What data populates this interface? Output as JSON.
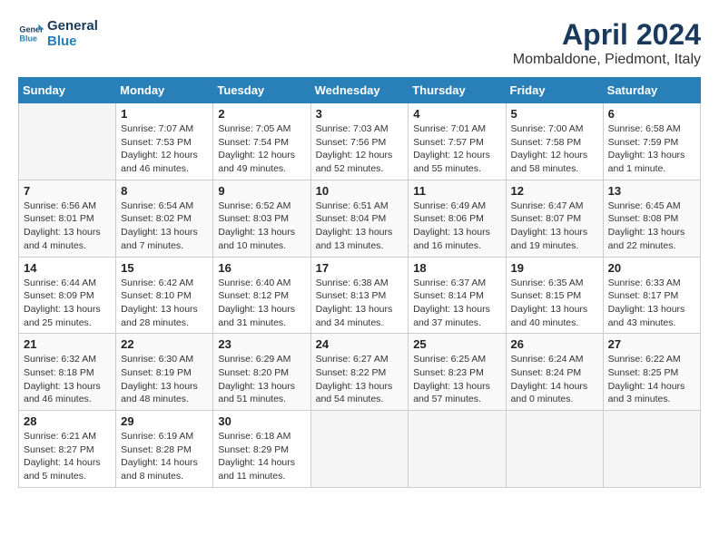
{
  "header": {
    "logo_line1": "General",
    "logo_line2": "Blue",
    "month_title": "April 2024",
    "location": "Mombaldone, Piedmont, Italy"
  },
  "columns": [
    "Sunday",
    "Monday",
    "Tuesday",
    "Wednesday",
    "Thursday",
    "Friday",
    "Saturday"
  ],
  "weeks": [
    [
      {
        "day": "",
        "info": ""
      },
      {
        "day": "1",
        "info": "Sunrise: 7:07 AM\nSunset: 7:53 PM\nDaylight: 12 hours\nand 46 minutes."
      },
      {
        "day": "2",
        "info": "Sunrise: 7:05 AM\nSunset: 7:54 PM\nDaylight: 12 hours\nand 49 minutes."
      },
      {
        "day": "3",
        "info": "Sunrise: 7:03 AM\nSunset: 7:56 PM\nDaylight: 12 hours\nand 52 minutes."
      },
      {
        "day": "4",
        "info": "Sunrise: 7:01 AM\nSunset: 7:57 PM\nDaylight: 12 hours\nand 55 minutes."
      },
      {
        "day": "5",
        "info": "Sunrise: 7:00 AM\nSunset: 7:58 PM\nDaylight: 12 hours\nand 58 minutes."
      },
      {
        "day": "6",
        "info": "Sunrise: 6:58 AM\nSunset: 7:59 PM\nDaylight: 13 hours\nand 1 minute."
      }
    ],
    [
      {
        "day": "7",
        "info": "Sunrise: 6:56 AM\nSunset: 8:01 PM\nDaylight: 13 hours\nand 4 minutes."
      },
      {
        "day": "8",
        "info": "Sunrise: 6:54 AM\nSunset: 8:02 PM\nDaylight: 13 hours\nand 7 minutes."
      },
      {
        "day": "9",
        "info": "Sunrise: 6:52 AM\nSunset: 8:03 PM\nDaylight: 13 hours\nand 10 minutes."
      },
      {
        "day": "10",
        "info": "Sunrise: 6:51 AM\nSunset: 8:04 PM\nDaylight: 13 hours\nand 13 minutes."
      },
      {
        "day": "11",
        "info": "Sunrise: 6:49 AM\nSunset: 8:06 PM\nDaylight: 13 hours\nand 16 minutes."
      },
      {
        "day": "12",
        "info": "Sunrise: 6:47 AM\nSunset: 8:07 PM\nDaylight: 13 hours\nand 19 minutes."
      },
      {
        "day": "13",
        "info": "Sunrise: 6:45 AM\nSunset: 8:08 PM\nDaylight: 13 hours\nand 22 minutes."
      }
    ],
    [
      {
        "day": "14",
        "info": "Sunrise: 6:44 AM\nSunset: 8:09 PM\nDaylight: 13 hours\nand 25 minutes."
      },
      {
        "day": "15",
        "info": "Sunrise: 6:42 AM\nSunset: 8:10 PM\nDaylight: 13 hours\nand 28 minutes."
      },
      {
        "day": "16",
        "info": "Sunrise: 6:40 AM\nSunset: 8:12 PM\nDaylight: 13 hours\nand 31 minutes."
      },
      {
        "day": "17",
        "info": "Sunrise: 6:38 AM\nSunset: 8:13 PM\nDaylight: 13 hours\nand 34 minutes."
      },
      {
        "day": "18",
        "info": "Sunrise: 6:37 AM\nSunset: 8:14 PM\nDaylight: 13 hours\nand 37 minutes."
      },
      {
        "day": "19",
        "info": "Sunrise: 6:35 AM\nSunset: 8:15 PM\nDaylight: 13 hours\nand 40 minutes."
      },
      {
        "day": "20",
        "info": "Sunrise: 6:33 AM\nSunset: 8:17 PM\nDaylight: 13 hours\nand 43 minutes."
      }
    ],
    [
      {
        "day": "21",
        "info": "Sunrise: 6:32 AM\nSunset: 8:18 PM\nDaylight: 13 hours\nand 46 minutes."
      },
      {
        "day": "22",
        "info": "Sunrise: 6:30 AM\nSunset: 8:19 PM\nDaylight: 13 hours\nand 48 minutes."
      },
      {
        "day": "23",
        "info": "Sunrise: 6:29 AM\nSunset: 8:20 PM\nDaylight: 13 hours\nand 51 minutes."
      },
      {
        "day": "24",
        "info": "Sunrise: 6:27 AM\nSunset: 8:22 PM\nDaylight: 13 hours\nand 54 minutes."
      },
      {
        "day": "25",
        "info": "Sunrise: 6:25 AM\nSunset: 8:23 PM\nDaylight: 13 hours\nand 57 minutes."
      },
      {
        "day": "26",
        "info": "Sunrise: 6:24 AM\nSunset: 8:24 PM\nDaylight: 14 hours\nand 0 minutes."
      },
      {
        "day": "27",
        "info": "Sunrise: 6:22 AM\nSunset: 8:25 PM\nDaylight: 14 hours\nand 3 minutes."
      }
    ],
    [
      {
        "day": "28",
        "info": "Sunrise: 6:21 AM\nSunset: 8:27 PM\nDaylight: 14 hours\nand 5 minutes."
      },
      {
        "day": "29",
        "info": "Sunrise: 6:19 AM\nSunset: 8:28 PM\nDaylight: 14 hours\nand 8 minutes."
      },
      {
        "day": "30",
        "info": "Sunrise: 6:18 AM\nSunset: 8:29 PM\nDaylight: 14 hours\nand 11 minutes."
      },
      {
        "day": "",
        "info": ""
      },
      {
        "day": "",
        "info": ""
      },
      {
        "day": "",
        "info": ""
      },
      {
        "day": "",
        "info": ""
      }
    ]
  ]
}
